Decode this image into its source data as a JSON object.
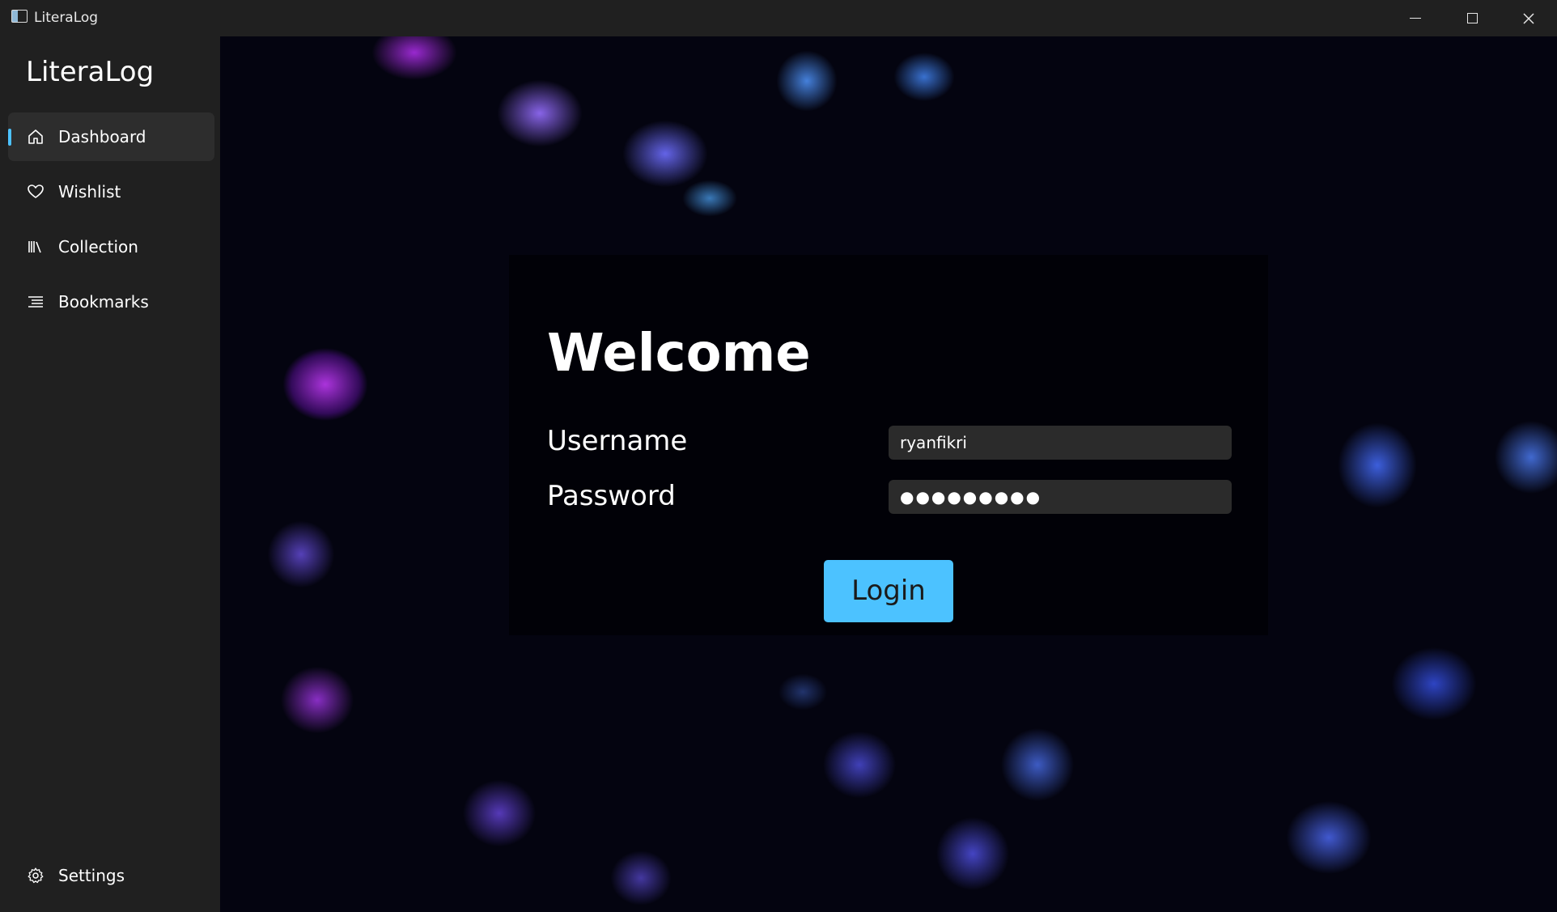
{
  "window": {
    "title": "LiteraLog",
    "icon": "app-window-icon",
    "controls": {
      "minimize_icon": "minimize-icon",
      "maximize_icon": "maximize-icon",
      "close_icon": "close-icon",
      "close_glyph": "✕"
    }
  },
  "sidebar": {
    "brand": "LiteraLog",
    "accent_color": "#4cc2ff",
    "items": [
      {
        "label": "Dashboard",
        "icon": "home-icon",
        "active": true
      },
      {
        "label": "Wishlist",
        "icon": "heart-icon",
        "active": false
      },
      {
        "label": "Collection",
        "icon": "library-icon",
        "active": false
      },
      {
        "label": "Bookmarks",
        "icon": "bookmarks-list-icon",
        "active": false
      }
    ],
    "footer": {
      "label": "Settings",
      "icon": "gear-icon"
    }
  },
  "login": {
    "heading": "Welcome",
    "username_label": "Username",
    "username_value": "ryanfikri",
    "password_label": "Password",
    "password_value": "●●●●●●●●●",
    "submit_label": "Login",
    "button_color": "#4cc2ff"
  },
  "background": {
    "description_icon": "jellyfish-background"
  }
}
